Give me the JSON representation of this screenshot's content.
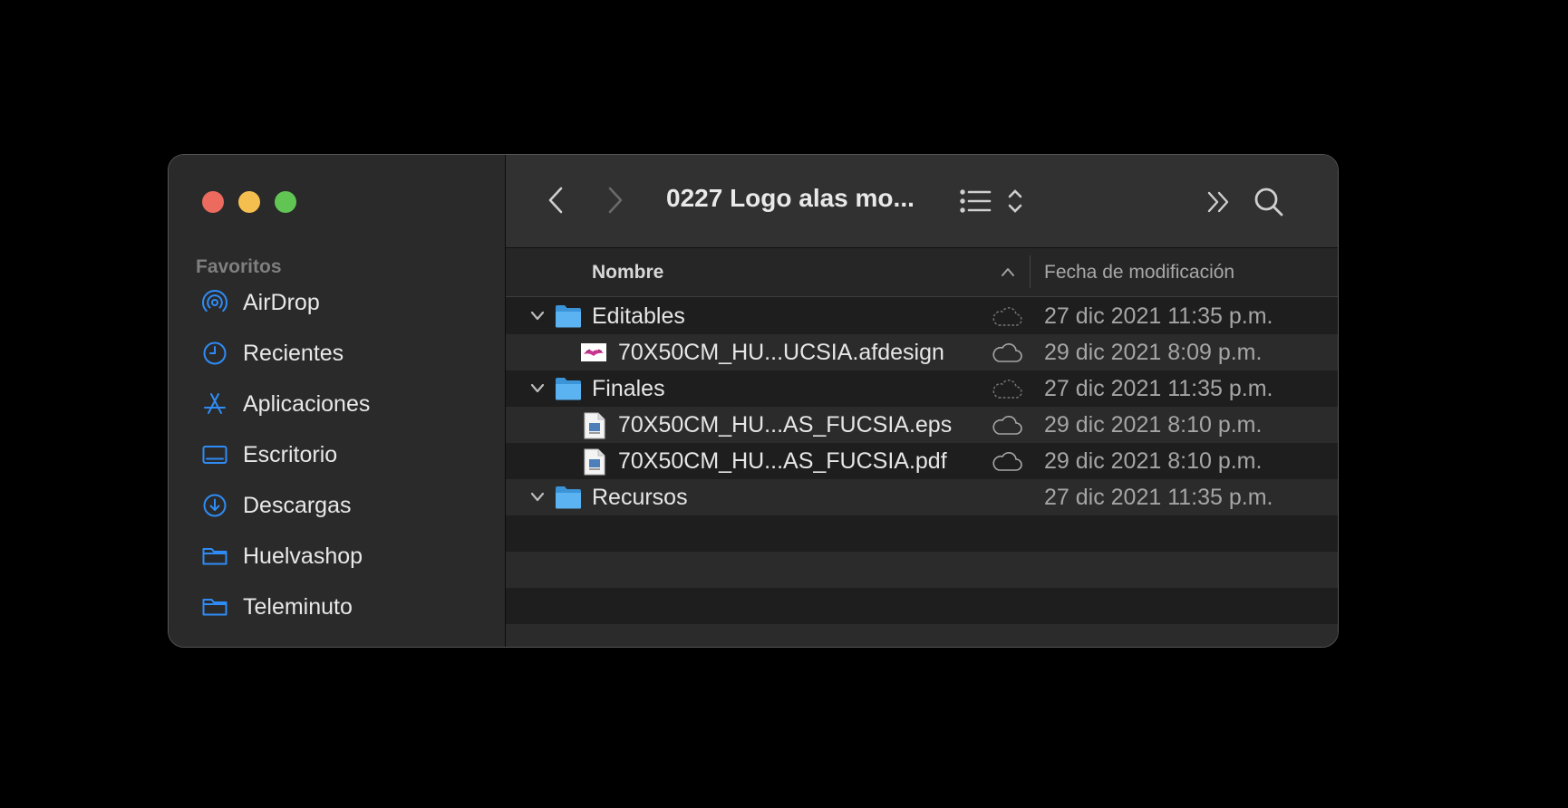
{
  "window": {
    "title": "0227 Logo alas mo..."
  },
  "sidebar": {
    "section_title": "Favoritos",
    "items": [
      {
        "label": "AirDrop",
        "icon": "airdrop-icon"
      },
      {
        "label": "Recientes",
        "icon": "clock-icon"
      },
      {
        "label": "Aplicaciones",
        "icon": "applications-icon"
      },
      {
        "label": "Escritorio",
        "icon": "desktop-icon"
      },
      {
        "label": "Descargas",
        "icon": "download-icon"
      },
      {
        "label": "Huelvashop",
        "icon": "folder-icon"
      },
      {
        "label": "Teleminuto",
        "icon": "folder-icon"
      }
    ]
  },
  "columns": {
    "name": "Nombre",
    "date": "Fecha de modificación"
  },
  "files": [
    {
      "name": "Editables",
      "kind": "folder",
      "date": "27 dic 2021 11:35 p.m.",
      "cloud": "dashed-cloud-icon"
    },
    {
      "name": "70X50CM_HU...UCSIA.afdesign",
      "kind": "afdesign-file",
      "date": "29 dic 2021 8:09 p.m.",
      "cloud": "cloud-icon"
    },
    {
      "name": "Finales",
      "kind": "folder",
      "date": "27 dic 2021 11:35 p.m.",
      "cloud": "dashed-cloud-icon"
    },
    {
      "name": "70X50CM_HU...AS_FUCSIA.eps",
      "kind": "eps-file",
      "date": "29 dic 2021 8:10 p.m.",
      "cloud": "cloud-icon"
    },
    {
      "name": "70X50CM_HU...AS_FUCSIA.pdf",
      "kind": "pdf-file",
      "date": "29 dic 2021 8:10 p.m.",
      "cloud": "cloud-icon"
    },
    {
      "name": "Recursos",
      "kind": "folder",
      "date": "27 dic 2021 11:35 p.m.",
      "cloud": ""
    }
  ],
  "colors": {
    "accent": "#2f8cf6",
    "folder": "#4aa8f0"
  }
}
